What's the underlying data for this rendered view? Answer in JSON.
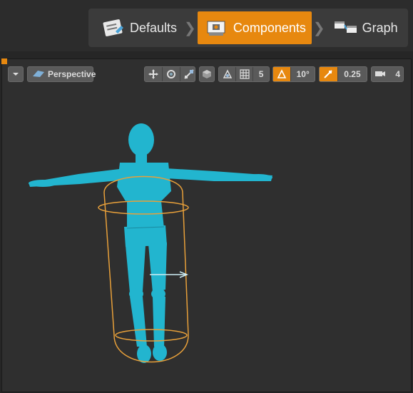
{
  "modes": {
    "defaults_label": "Defaults",
    "components_label": "Components",
    "graph_label": "Graph",
    "separator": "❯"
  },
  "viewport": {
    "view_mode_label": "Perspective",
    "grid_size": "5",
    "rotation_snap": "10°",
    "scale_snap": "0.25",
    "camera_speed": "4"
  },
  "colors": {
    "accent": "#e7880f",
    "mannequin": "#22b5cf",
    "capsule": "#e8a03a"
  }
}
